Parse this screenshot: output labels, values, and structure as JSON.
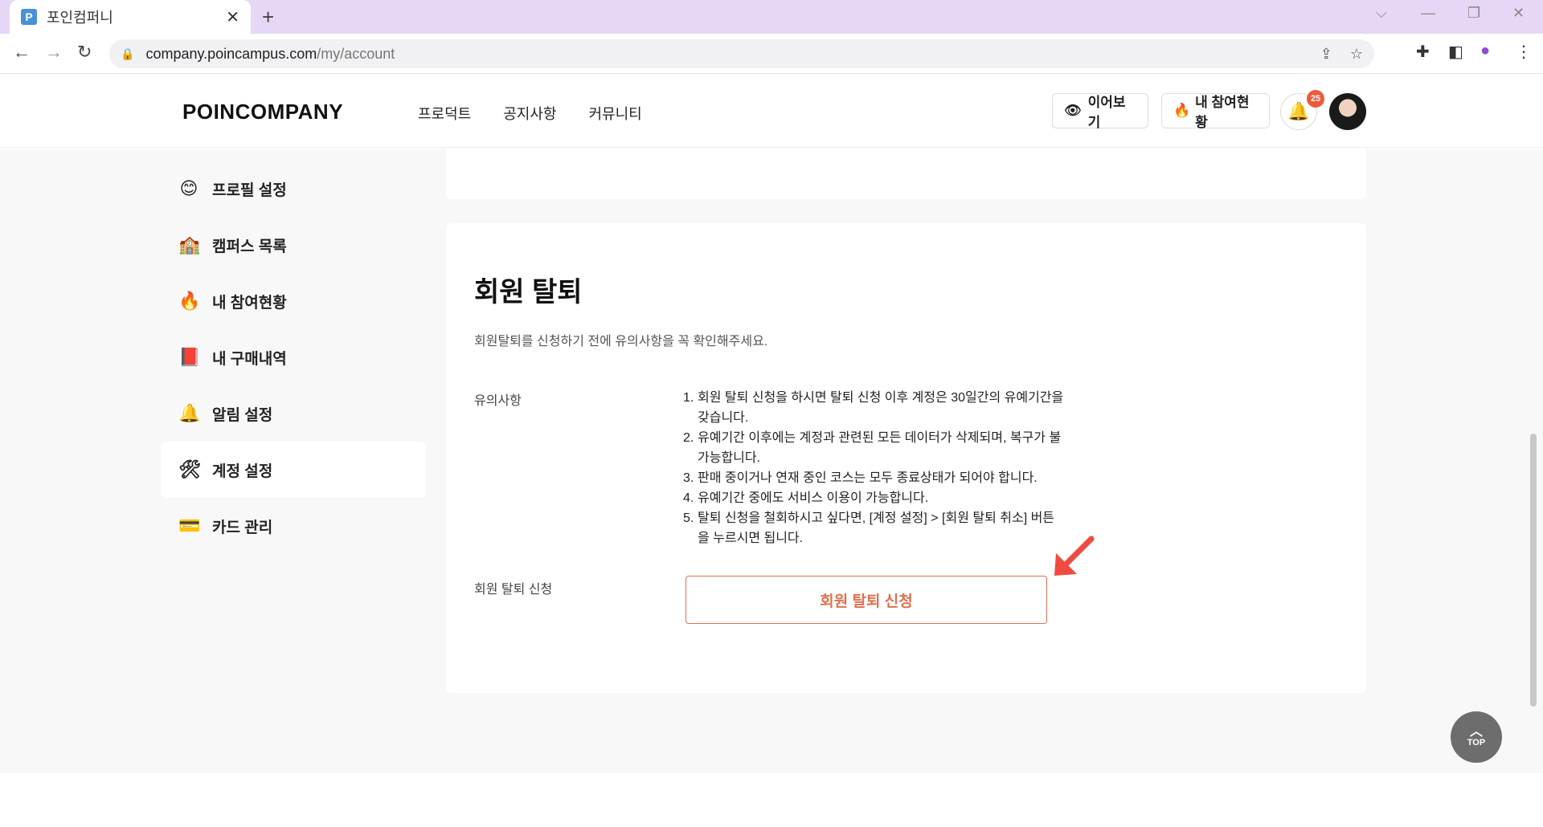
{
  "browser": {
    "tab_title": "포인컴퍼니",
    "favicon_letter": "P",
    "url_domain": "company.poincampus.com",
    "url_path": "/my/account"
  },
  "header": {
    "logo": "POINCOMPANY",
    "nav": [
      "프로덕트",
      "공지사항",
      "커뮤니티"
    ],
    "continue_label": "이어보기",
    "participation_label": "내 참여현황",
    "notification_count": "25"
  },
  "sidebar": {
    "items": [
      {
        "icon": "😊",
        "label": "프로필 설정"
      },
      {
        "icon": "🏫",
        "label": "캠퍼스 목록"
      },
      {
        "icon": "🔥",
        "label": "내 참여현황"
      },
      {
        "icon": "📕",
        "label": "내 구매내역"
      },
      {
        "icon": "🔔",
        "label": "알림 설정"
      },
      {
        "icon": "🛠",
        "label": "계정 설정"
      },
      {
        "icon": "💳",
        "label": "카드 관리"
      }
    ],
    "active_index": 5
  },
  "withdrawal": {
    "title": "회원 탈퇴",
    "description": "회원탈퇴를 신청하기 전에 유의사항을 꼭 확인해주세요.",
    "notes_label": "유의사항",
    "notes": [
      {
        "n": "1.",
        "text": "회원 탈퇴 신청을 하시면 탈퇴 신청 이후 계정은 30일간의 유예기간을 갖습니다."
      },
      {
        "n": "2.",
        "text": "유예기간 이후에는 계정과 관련된 모든 데이터가 삭제되며, 복구가 불가능합니다."
      },
      {
        "n": "3.",
        "text": "판매 중이거나 연재 중인 코스는 모두 종료상태가 되어야 합니다."
      },
      {
        "n": "4.",
        "text": "유예기간 중에도 서비스 이용이 가능합니다."
      },
      {
        "n": "5.",
        "text": "탈퇴 신청을 철회하시고 싶다면, [계정 설정] > [회원 탈퇴 취소] 버튼을 누르시면 됩니다."
      }
    ],
    "apply_label": "회원 탈퇴 신청",
    "apply_button": "회원 탈퇴 신청"
  },
  "top_button": "TOP",
  "colors": {
    "accent": "#e0704f",
    "tabbar": "#e7d7f6",
    "badge": "#ee5a3a"
  }
}
